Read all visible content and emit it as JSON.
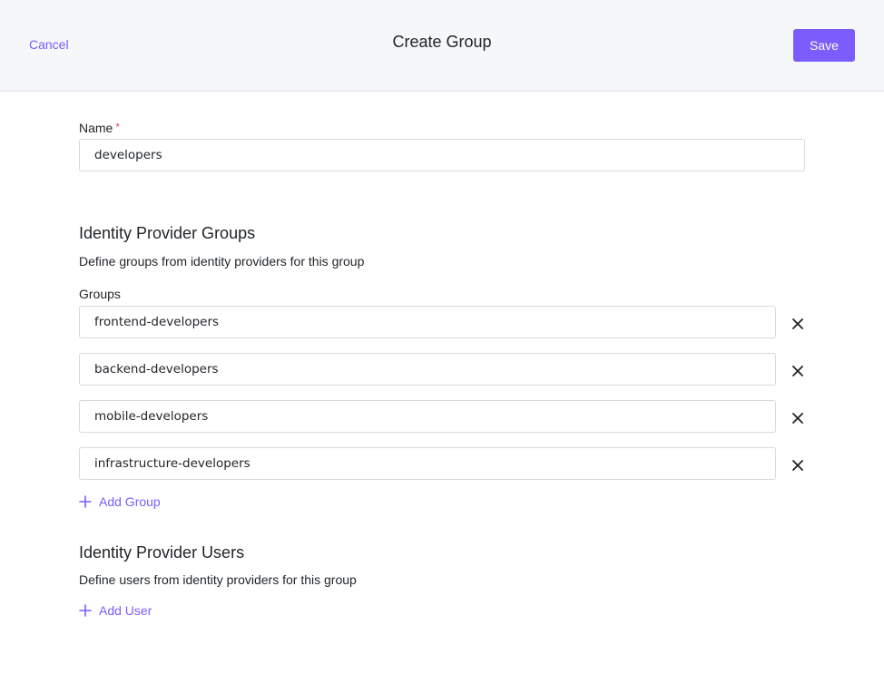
{
  "header": {
    "cancel_label": "Cancel",
    "title": "Create Group",
    "save_label": "Save"
  },
  "name_field": {
    "label": "Name",
    "required_mark": "*",
    "value": "developers"
  },
  "idp_groups": {
    "title": "Identity Provider Groups",
    "description": "Define groups from identity providers for this group",
    "groups_label": "Groups",
    "groups": [
      {
        "value": "frontend-developers"
      },
      {
        "value": "backend-developers"
      },
      {
        "value": "mobile-developers"
      },
      {
        "value": "infrastructure-developers"
      }
    ],
    "add_label": "Add Group"
  },
  "idp_users": {
    "title": "Identity Provider Users",
    "description": "Define users from identity providers for this group",
    "add_label": "Add User"
  },
  "colors": {
    "accent": "#7c5cfc",
    "required": "#e5484d",
    "header_bg": "#f6f7f9"
  },
  "icons": {
    "remove": "close-icon",
    "add": "plus-icon"
  }
}
